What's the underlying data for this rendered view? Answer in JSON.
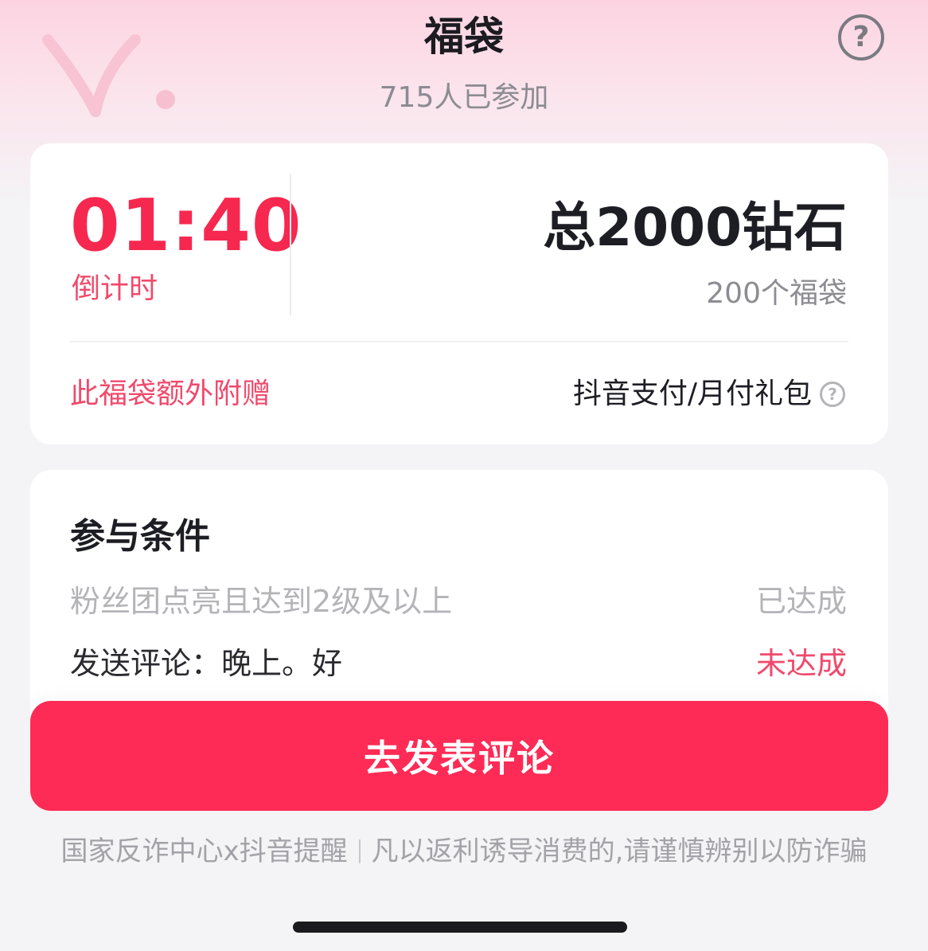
{
  "header": {
    "title": "福袋",
    "participants": "715人已参加",
    "help_icon": "question-circle-icon"
  },
  "prize_card": {
    "countdown_value": "01:40",
    "countdown_label": "倒计时",
    "total_prize": "总2000钻石",
    "bag_count": "200个福袋",
    "extra_label": "此福袋额外附赠",
    "extra_value": "抖音支付/月付礼包",
    "extra_help_icon": "question-circle-icon"
  },
  "conditions": {
    "title": "参与条件",
    "items": [
      {
        "text": "粉丝团点亮且达到2级及以上",
        "status": "已达成"
      },
      {
        "text": "发送评论：晚上。好",
        "status": "未达成"
      }
    ]
  },
  "action": {
    "label": "去发表评论"
  },
  "footer": {
    "left": "国家反诈中心x抖音提醒",
    "right": "凡以返利诱导消费的,请谨慎辨别以防诈骗"
  },
  "colors": {
    "accent": "#fd2b55",
    "accent_text": "#f04a6c",
    "background": "#f4f4f6",
    "header_gradient_top": "#fcd4e1"
  }
}
